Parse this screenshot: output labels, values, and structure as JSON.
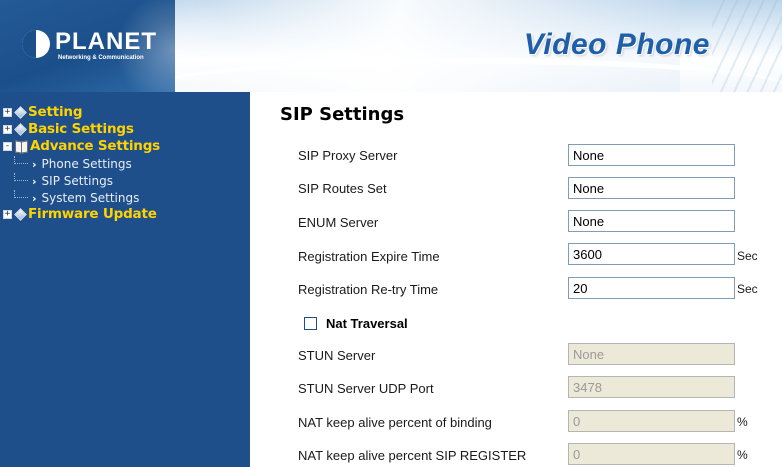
{
  "header": {
    "logo_text": "PLANET",
    "logo_tagline": "Networking & Communication",
    "product_title": "Video Phone"
  },
  "sidebar": {
    "items": [
      {
        "label": "Setting",
        "toggle": "+",
        "icon": "diamond-icon"
      },
      {
        "label": "Basic Settings",
        "toggle": "+",
        "icon": "diamond-icon"
      },
      {
        "label": "Advance Settings",
        "toggle": "-",
        "icon": "book-icon",
        "children": [
          {
            "label": "Phone Settings"
          },
          {
            "label": "SIP Settings"
          },
          {
            "label": "System Settings"
          }
        ]
      },
      {
        "label": "Firmware Update",
        "toggle": "+",
        "icon": "diamond-icon"
      }
    ]
  },
  "main": {
    "title": "SIP Settings",
    "fields": {
      "sip_proxy_server": {
        "label": "SIP Proxy Server",
        "value": "None"
      },
      "sip_routes_set": {
        "label": "SIP Routes Set",
        "value": "None"
      },
      "enum_server": {
        "label": "ENUM Server",
        "value": "None"
      },
      "registration_expire_time": {
        "label": "Registration Expire Time",
        "value": "3600",
        "unit": "Sec"
      },
      "registration_retry_time": {
        "label": "Registration Re-try Time",
        "value": "20",
        "unit": "Sec"
      },
      "nat_traversal": {
        "label": "Nat Traversal",
        "checked": false
      },
      "stun_server": {
        "label": "STUN Server",
        "value": "None",
        "disabled": true
      },
      "stun_server_udp_port": {
        "label": "STUN Server UDP Port",
        "value": "3478",
        "disabled": true
      },
      "nat_keep_alive_binding": {
        "label": "NAT keep alive percent of binding",
        "value": "0",
        "unit": "%",
        "disabled": true
      },
      "nat_keep_alive_register": {
        "label": "NAT keep alive percent SIP REGISTER",
        "value": "0",
        "unit": "%",
        "disabled": true
      }
    }
  },
  "colors": {
    "sidebar_bg": "#1f4f8a",
    "sidebar_heading": "#ffd200",
    "brand_blue": "#1f5ea8",
    "disabled_input_bg": "#ece9d8"
  }
}
